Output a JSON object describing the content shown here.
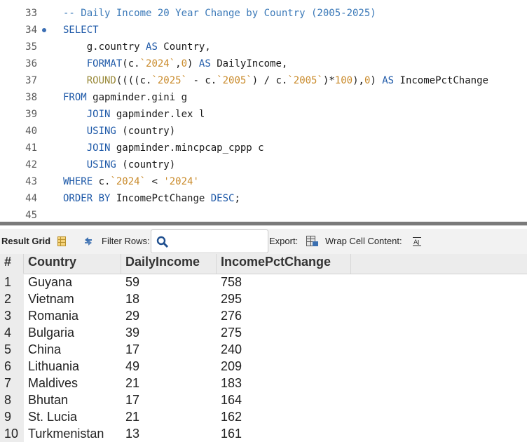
{
  "editor": {
    "lines": [
      {
        "num": "33",
        "segments": [
          {
            "t": "-- Daily Income 20 Year Change by Country (2005-2025)",
            "c": "cmt"
          }
        ]
      },
      {
        "num": "34",
        "breakpoint": true,
        "segments": [
          {
            "t": "SELECT",
            "c": "kw"
          }
        ]
      },
      {
        "num": "35",
        "segments": [
          {
            "t": "    g.country ",
            "c": ""
          },
          {
            "t": "AS",
            "c": "kw"
          },
          {
            "t": " Country,",
            "c": ""
          }
        ]
      },
      {
        "num": "36",
        "segments": [
          {
            "t": "    ",
            "c": ""
          },
          {
            "t": "FORMAT",
            "c": "kw"
          },
          {
            "t": "(c.",
            "c": ""
          },
          {
            "t": "`2024`",
            "c": "str"
          },
          {
            "t": ",",
            "c": ""
          },
          {
            "t": "0",
            "c": "num"
          },
          {
            "t": ") ",
            "c": ""
          },
          {
            "t": "AS",
            "c": "kw"
          },
          {
            "t": " DailyIncome,",
            "c": ""
          }
        ]
      },
      {
        "num": "37",
        "segments": [
          {
            "t": "    ",
            "c": ""
          },
          {
            "t": "ROUND",
            "c": "fn"
          },
          {
            "t": "((((c.",
            "c": ""
          },
          {
            "t": "`2025`",
            "c": "str"
          },
          {
            "t": " - c.",
            "c": ""
          },
          {
            "t": "`2005`",
            "c": "str"
          },
          {
            "t": ") / c.",
            "c": ""
          },
          {
            "t": "`2005`",
            "c": "str"
          },
          {
            "t": ")*",
            "c": ""
          },
          {
            "t": "100",
            "c": "num"
          },
          {
            "t": "),",
            "c": ""
          },
          {
            "t": "0",
            "c": "num"
          },
          {
            "t": ") ",
            "c": ""
          },
          {
            "t": "AS",
            "c": "kw"
          },
          {
            "t": " IncomePctChange",
            "c": ""
          }
        ]
      },
      {
        "num": "38",
        "segments": [
          {
            "t": "FROM",
            "c": "kw"
          },
          {
            "t": " gapminder.gini g",
            "c": ""
          }
        ]
      },
      {
        "num": "39",
        "segments": [
          {
            "t": "    ",
            "c": ""
          },
          {
            "t": "JOIN",
            "c": "kw"
          },
          {
            "t": " gapminder.lex l",
            "c": ""
          }
        ]
      },
      {
        "num": "40",
        "segments": [
          {
            "t": "    ",
            "c": ""
          },
          {
            "t": "USING",
            "c": "kw"
          },
          {
            "t": " (country)",
            "c": ""
          }
        ]
      },
      {
        "num": "41",
        "segments": [
          {
            "t": "    ",
            "c": ""
          },
          {
            "t": "JOIN",
            "c": "kw"
          },
          {
            "t": " gapminder.mincpcap_cppp c",
            "c": ""
          }
        ]
      },
      {
        "num": "42",
        "segments": [
          {
            "t": "    ",
            "c": ""
          },
          {
            "t": "USING",
            "c": "kw"
          },
          {
            "t": " (country)",
            "c": ""
          }
        ]
      },
      {
        "num": "43",
        "segments": [
          {
            "t": "WHERE",
            "c": "kw"
          },
          {
            "t": " c.",
            "c": ""
          },
          {
            "t": "`2024`",
            "c": "str"
          },
          {
            "t": " < ",
            "c": ""
          },
          {
            "t": "'2024'",
            "c": "str"
          }
        ]
      },
      {
        "num": "44",
        "segments": [
          {
            "t": "ORDER BY",
            "c": "kw"
          },
          {
            "t": " IncomePctChange ",
            "c": ""
          },
          {
            "t": "DESC",
            "c": "kw"
          },
          {
            "t": ";",
            "c": ""
          }
        ]
      },
      {
        "num": "45",
        "segments": []
      }
    ]
  },
  "toolbar": {
    "result_grid_label": "Result Grid",
    "filter_rows_label": "Filter Rows:",
    "filter_value": "",
    "export_label": "Export:",
    "wrap_label": "Wrap Cell Content:",
    "icons": [
      "grid-icon",
      "refresh-icon",
      "search-icon",
      "export-icon",
      "wrap-icon"
    ]
  },
  "grid": {
    "columns": [
      "#",
      "Country",
      "DailyIncome",
      "IncomePctChange"
    ],
    "rows": [
      [
        "1",
        "Guyana",
        "59",
        "758"
      ],
      [
        "2",
        "Vietnam",
        "18",
        "295"
      ],
      [
        "3",
        "Romania",
        "29",
        "276"
      ],
      [
        "4",
        "Bulgaria",
        "39",
        "275"
      ],
      [
        "5",
        "China",
        "17",
        "240"
      ],
      [
        "6",
        "Lithuania",
        "49",
        "209"
      ],
      [
        "7",
        "Maldives",
        "21",
        "183"
      ],
      [
        "8",
        "Bhutan",
        "17",
        "164"
      ],
      [
        "9",
        "St. Lucia",
        "21",
        "162"
      ],
      [
        "10",
        "Turkmenistan",
        "13",
        "161"
      ]
    ]
  },
  "colors": {
    "keyword": "#1e59a8",
    "comment": "#3b79b8",
    "string": "#c98a2a",
    "function": "#9a8a3a"
  }
}
